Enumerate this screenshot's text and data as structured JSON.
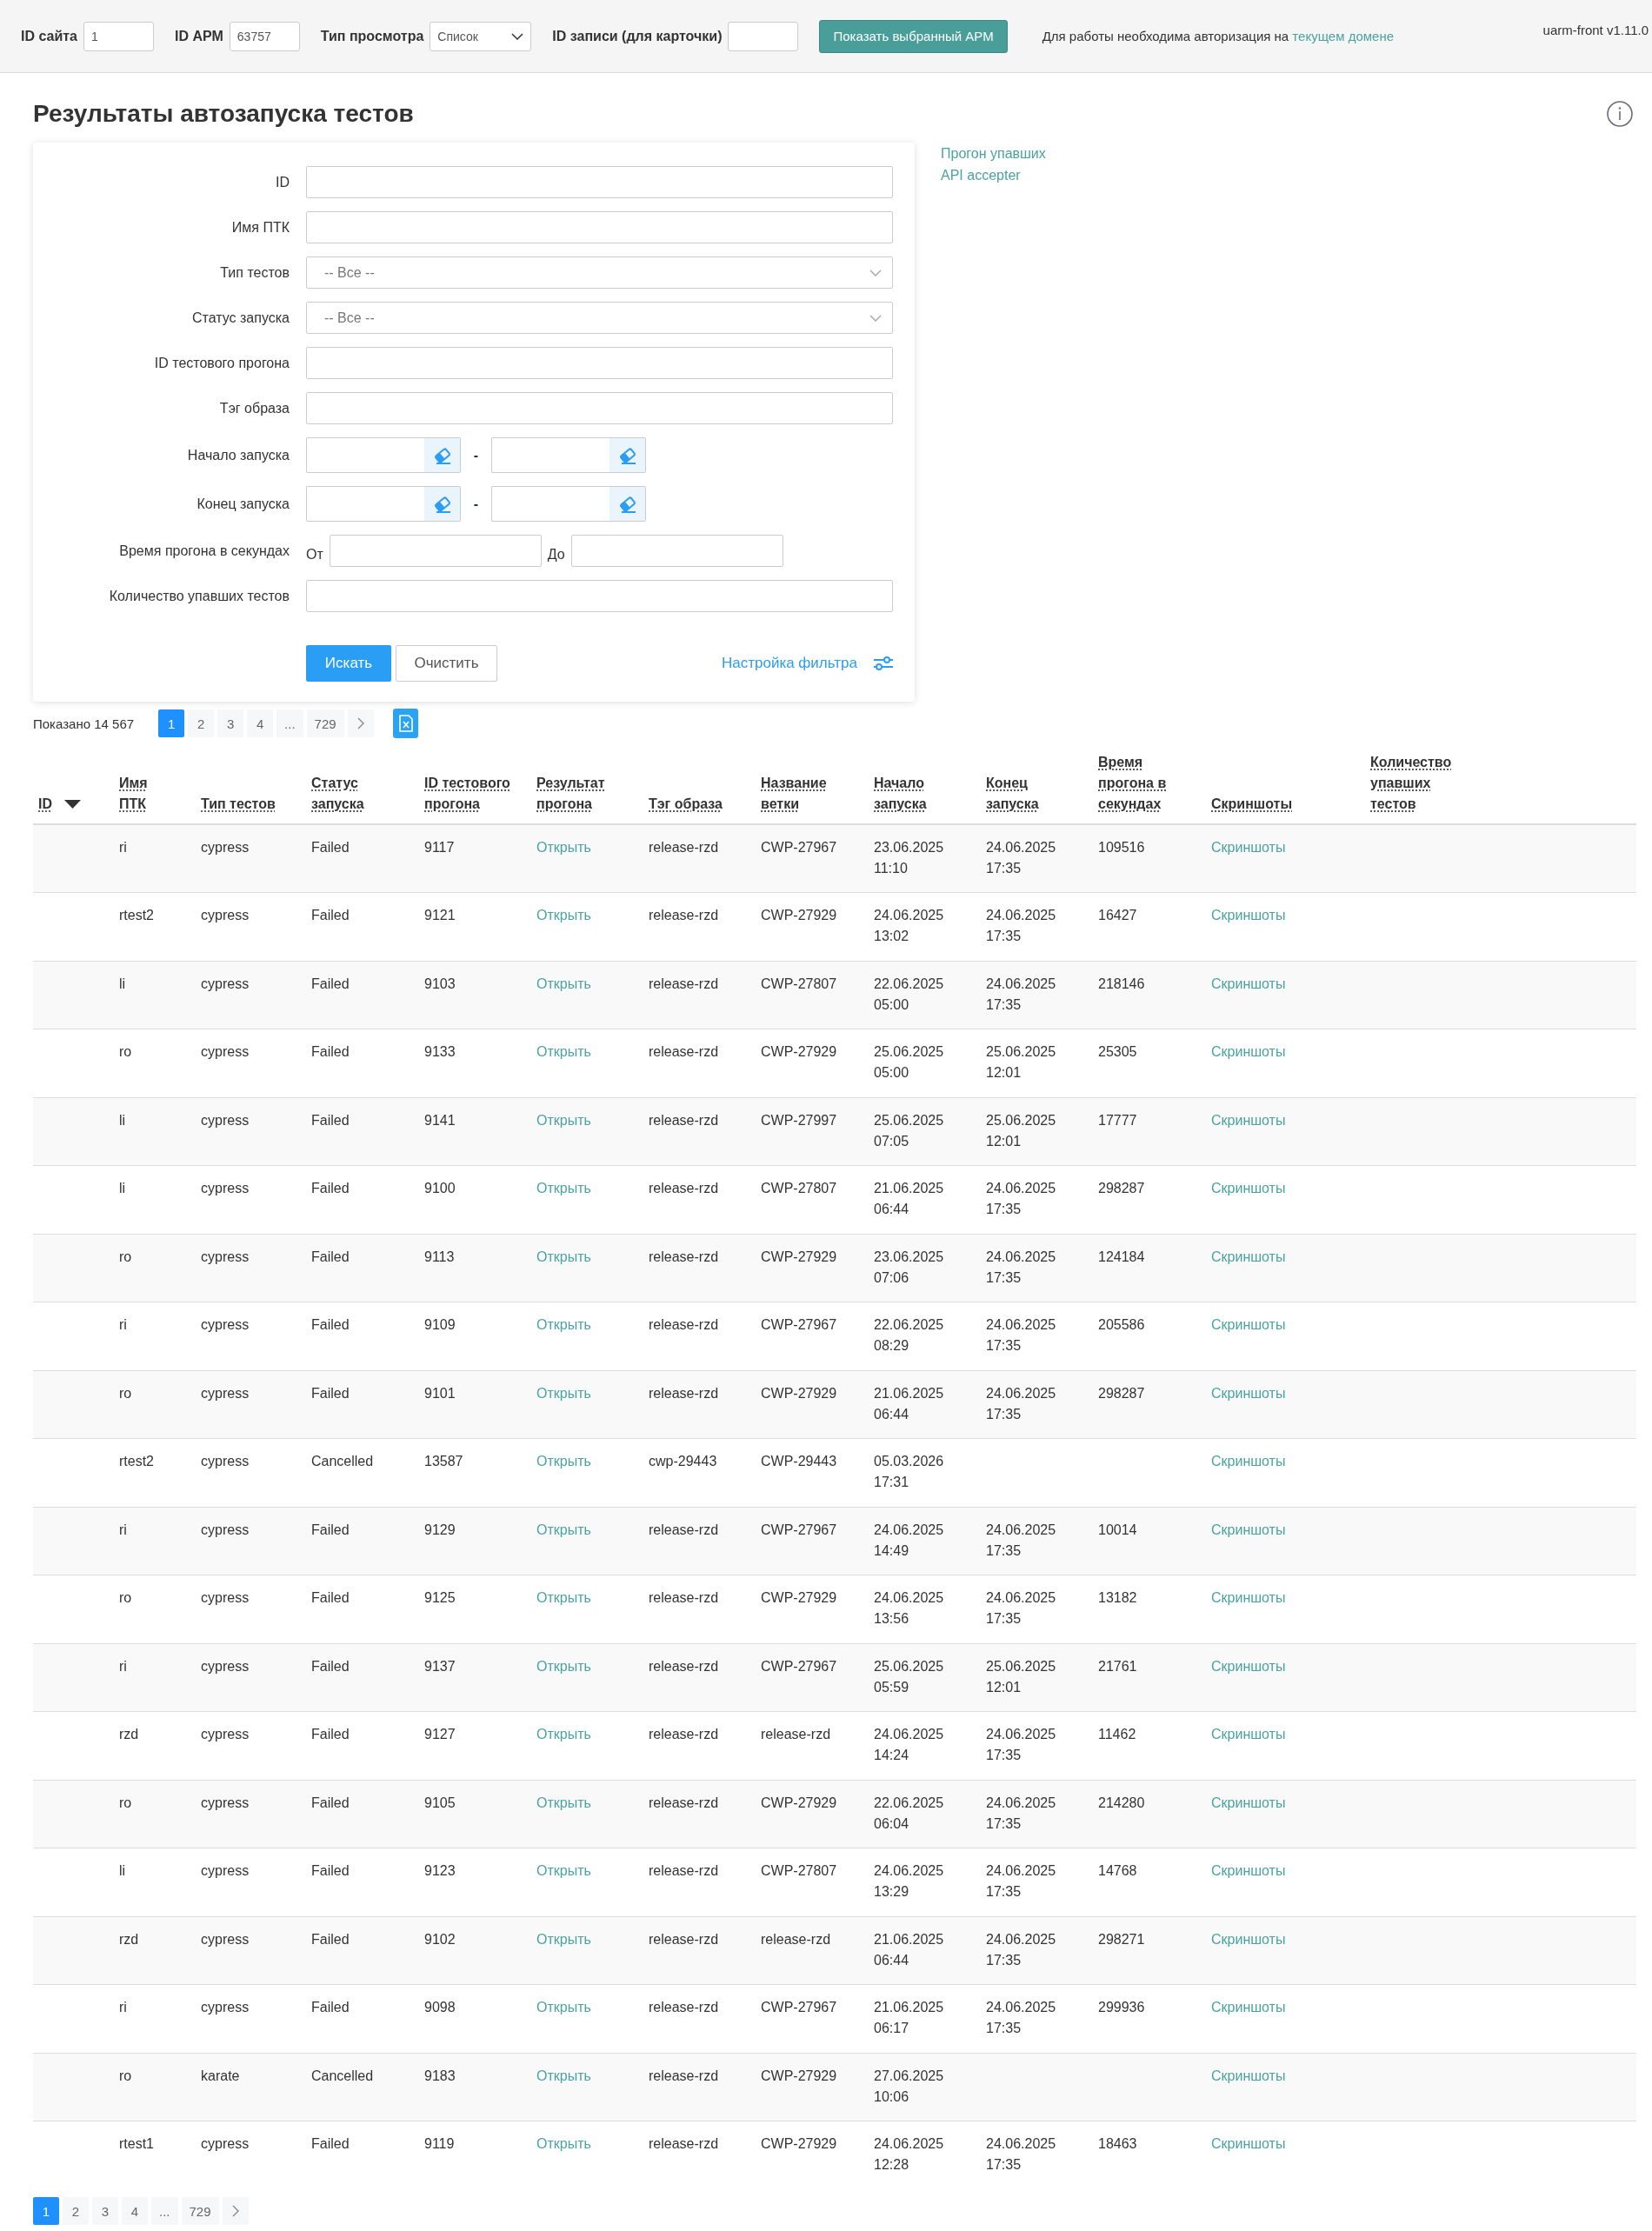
{
  "top_bar": {
    "fields": [
      {
        "kind": "input",
        "label": "ID сайта",
        "value": "1"
      },
      {
        "kind": "input",
        "label": "ID АРМ",
        "value": "63757"
      },
      {
        "kind": "select",
        "label": "Тип просмотра",
        "value": "Список"
      },
      {
        "kind": "input",
        "label": "ID записи (для карточки)"
      }
    ],
    "show_button": "Показать выбранный АРМ",
    "auth_notice": {
      "text": "Для работы необходима авторизация на",
      "link": "текущем домене"
    },
    "version": "uarm-front v1.11.0"
  },
  "page_title": "Результаты автозапуска тестов",
  "filter": {
    "fields": [
      {
        "kind": "text",
        "label": "ID"
      },
      {
        "kind": "text",
        "label": "Имя ПТК"
      },
      {
        "kind": "select",
        "label": "Тип тестов",
        "value": "-- Все --"
      },
      {
        "kind": "select",
        "label": "Статус запуска",
        "value": "-- Все --"
      },
      {
        "kind": "text",
        "label": "ID тестового прогона"
      },
      {
        "kind": "text",
        "label": "Тэг образа"
      },
      {
        "kind": "date_range",
        "label": "Начало запуска",
        "separator": "-"
      },
      {
        "kind": "date_range",
        "label": "Конец запуска",
        "separator": "-"
      },
      {
        "kind": "number_range",
        "label": "Время прогона в секундах",
        "from": "От",
        "to": "До"
      },
      {
        "kind": "text",
        "label": "Количество упавших тестов"
      }
    ],
    "search_button": "Искать",
    "clear_button": "Очистить",
    "settings_link": "Настройка фильтра"
  },
  "side_links": [
    "Прогон упавших",
    "API accepter"
  ],
  "summary": "Показано 14 567",
  "pagination_top": [
    {
      "label": "1",
      "selected": true
    },
    {
      "label": "2",
      "selected": false
    },
    {
      "label": "3",
      "selected": false
    },
    {
      "label": "4",
      "selected": false
    },
    {
      "label": "...",
      "selected": false
    },
    {
      "label": "729",
      "selected": false
    }
  ],
  "table": {
    "columns": [
      {
        "label": "ID",
        "sorted_descending": true
      },
      {
        "label": "Имя ПТК",
        "sorted_descending": false
      },
      {
        "label": "Тип тестов",
        "sorted_descending": false
      },
      {
        "label": "Статус запуска",
        "sorted_descending": false
      },
      {
        "label": "ID тестового прогона",
        "sorted_descending": false
      },
      {
        "label": "Результат прогона",
        "sorted_descending": false
      },
      {
        "label": "Тэг образа",
        "sorted_descending": false
      },
      {
        "label": "Название ветки",
        "sorted_descending": false
      },
      {
        "label": "Начало запуска",
        "sorted_descending": false
      },
      {
        "label": "Конец запуска",
        "sorted_descending": false
      },
      {
        "label": "Время прогона в секундах",
        "sorted_descending": false
      },
      {
        "label": "Скриншоты",
        "sorted_descending": false
      },
      {
        "label": "Количество упавших тестов",
        "sorted_descending": false
      }
    ],
    "rows": [
      {
        "ptk": "ri",
        "test_type": "cypress",
        "status": "Failed",
        "run_id": "9117",
        "result": "Открыть",
        "image_tag": "release-rzd",
        "branch": "CWP-27967",
        "start": "23.06.2025 11:10",
        "end": "24.06.2025 17:35",
        "duration": "109516",
        "screenshots": "Скриншоты"
      },
      {
        "ptk": "rtest2",
        "test_type": "cypress",
        "status": "Failed",
        "run_id": "9121",
        "result": "Открыть",
        "image_tag": "release-rzd",
        "branch": "CWP-27929",
        "start": "24.06.2025 13:02",
        "end": "24.06.2025 17:35",
        "duration": "16427",
        "screenshots": "Скриншоты"
      },
      {
        "ptk": "li",
        "test_type": "cypress",
        "status": "Failed",
        "run_id": "9103",
        "result": "Открыть",
        "image_tag": "release-rzd",
        "branch": "CWP-27807",
        "start": "22.06.2025 05:00",
        "end": "24.06.2025 17:35",
        "duration": "218146",
        "screenshots": "Скриншоты"
      },
      {
        "ptk": "ro",
        "test_type": "cypress",
        "status": "Failed",
        "run_id": "9133",
        "result": "Открыть",
        "image_tag": "release-rzd",
        "branch": "CWP-27929",
        "start": "25.06.2025 05:00",
        "end": "25.06.2025 12:01",
        "duration": "25305",
        "screenshots": "Скриншоты"
      },
      {
        "ptk": "li",
        "test_type": "cypress",
        "status": "Failed",
        "run_id": "9141",
        "result": "Открыть",
        "image_tag": "release-rzd",
        "branch": "CWP-27997",
        "start": "25.06.2025 07:05",
        "end": "25.06.2025 12:01",
        "duration": "17777",
        "screenshots": "Скриншоты"
      },
      {
        "ptk": "li",
        "test_type": "cypress",
        "status": "Failed",
        "run_id": "9100",
        "result": "Открыть",
        "image_tag": "release-rzd",
        "branch": "CWP-27807",
        "start": "21.06.2025 06:44",
        "end": "24.06.2025 17:35",
        "duration": "298287",
        "screenshots": "Скриншоты"
      },
      {
        "ptk": "ro",
        "test_type": "cypress",
        "status": "Failed",
        "run_id": "9113",
        "result": "Открыть",
        "image_tag": "release-rzd",
        "branch": "CWP-27929",
        "start": "23.06.2025 07:06",
        "end": "24.06.2025 17:35",
        "duration": "124184",
        "screenshots": "Скриншоты"
      },
      {
        "ptk": "ri",
        "test_type": "cypress",
        "status": "Failed",
        "run_id": "9109",
        "result": "Открыть",
        "image_tag": "release-rzd",
        "branch": "CWP-27967",
        "start": "22.06.2025 08:29",
        "end": "24.06.2025 17:35",
        "duration": "205586",
        "screenshots": "Скриншоты"
      },
      {
        "ptk": "ro",
        "test_type": "cypress",
        "status": "Failed",
        "run_id": "9101",
        "result": "Открыть",
        "image_tag": "release-rzd",
        "branch": "CWP-27929",
        "start": "21.06.2025 06:44",
        "end": "24.06.2025 17:35",
        "duration": "298287",
        "screenshots": "Скриншоты"
      },
      {
        "ptk": "rtest2",
        "test_type": "cypress",
        "status": "Cancelled",
        "run_id": "13587",
        "result": "Открыть",
        "image_tag": "cwp-29443",
        "branch": "CWP-29443",
        "start": "05.03.2026 17:31",
        "screenshots": "Скриншоты"
      },
      {
        "ptk": "ri",
        "test_type": "cypress",
        "status": "Failed",
        "run_id": "9129",
        "result": "Открыть",
        "image_tag": "release-rzd",
        "branch": "CWP-27967",
        "start": "24.06.2025 14:49",
        "end": "24.06.2025 17:35",
        "duration": "10014",
        "screenshots": "Скриншоты"
      },
      {
        "ptk": "ro",
        "test_type": "cypress",
        "status": "Failed",
        "run_id": "9125",
        "result": "Открыть",
        "image_tag": "release-rzd",
        "branch": "CWP-27929",
        "start": "24.06.2025 13:56",
        "end": "24.06.2025 17:35",
        "duration": "13182",
        "screenshots": "Скриншоты"
      },
      {
        "ptk": "ri",
        "test_type": "cypress",
        "status": "Failed",
        "run_id": "9137",
        "result": "Открыть",
        "image_tag": "release-rzd",
        "branch": "CWP-27967",
        "start": "25.06.2025 05:59",
        "end": "25.06.2025 12:01",
        "duration": "21761",
        "screenshots": "Скриншоты"
      },
      {
        "ptk": "rzd",
        "test_type": "cypress",
        "status": "Failed",
        "run_id": "9127",
        "result": "Открыть",
        "image_tag": "release-rzd",
        "branch": "release-rzd",
        "start": "24.06.2025 14:24",
        "end": "24.06.2025 17:35",
        "duration": "11462",
        "screenshots": "Скриншоты"
      },
      {
        "ptk": "ro",
        "test_type": "cypress",
        "status": "Failed",
        "run_id": "9105",
        "result": "Открыть",
        "image_tag": "release-rzd",
        "branch": "CWP-27929",
        "start": "22.06.2025 06:04",
        "end": "24.06.2025 17:35",
        "duration": "214280",
        "screenshots": "Скриншоты"
      },
      {
        "ptk": "li",
        "test_type": "cypress",
        "status": "Failed",
        "run_id": "9123",
        "result": "Открыть",
        "image_tag": "release-rzd",
        "branch": "CWP-27807",
        "start": "24.06.2025 13:29",
        "end": "24.06.2025 17:35",
        "duration": "14768",
        "screenshots": "Скриншоты"
      },
      {
        "ptk": "rzd",
        "test_type": "cypress",
        "status": "Failed",
        "run_id": "9102",
        "result": "Открыть",
        "image_tag": "release-rzd",
        "branch": "release-rzd",
        "start": "21.06.2025 06:44",
        "end": "24.06.2025 17:35",
        "duration": "298271",
        "screenshots": "Скриншоты"
      },
      {
        "ptk": "ri",
        "test_type": "cypress",
        "status": "Failed",
        "run_id": "9098",
        "result": "Открыть",
        "image_tag": "release-rzd",
        "branch": "CWP-27967",
        "start": "21.06.2025 06:17",
        "end": "24.06.2025 17:35",
        "duration": "299936",
        "screenshots": "Скриншоты"
      },
      {
        "ptk": "ro",
        "test_type": "karate",
        "status": "Cancelled",
        "run_id": "9183",
        "result": "Открыть",
        "image_tag": "release-rzd",
        "branch": "CWP-27929",
        "start": "27.06.2025 10:06",
        "screenshots": "Скриншоты"
      },
      {
        "ptk": "rtest1",
        "test_type": "cypress",
        "status": "Failed",
        "run_id": "9119",
        "result": "Открыть",
        "image_tag": "release-rzd",
        "branch": "CWP-27929",
        "start": "24.06.2025 12:28",
        "end": "24.06.2025 17:35",
        "duration": "18463",
        "screenshots": "Скриншоты"
      }
    ]
  },
  "pagination_bottom": [
    {
      "label": "1",
      "selected": true
    },
    {
      "label": "2",
      "selected": false
    },
    {
      "label": "3",
      "selected": false
    },
    {
      "label": "4",
      "selected": false
    },
    {
      "label": "...",
      "selected": false
    },
    {
      "label": "729",
      "selected": false
    }
  ]
}
